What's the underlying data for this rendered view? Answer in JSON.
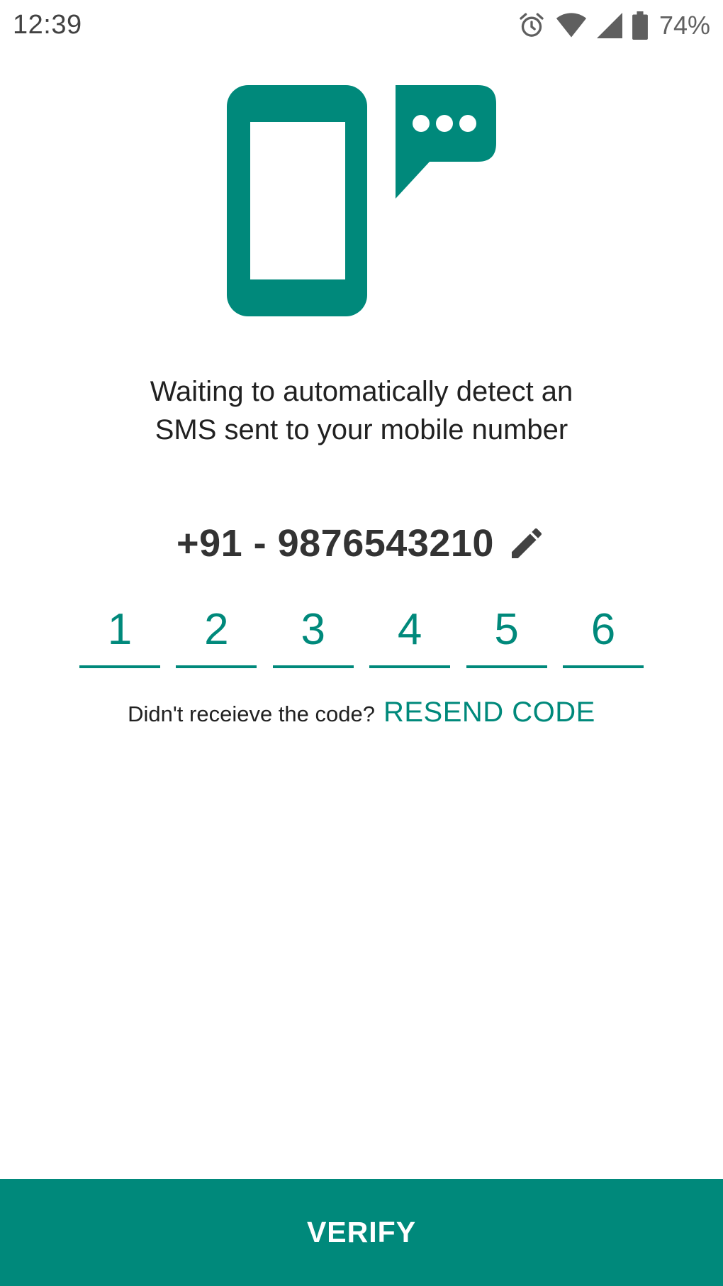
{
  "status_bar": {
    "time": "12:39",
    "battery_percent": "74%",
    "icons": [
      "alarm-icon",
      "wifi-icon",
      "cell-signal-icon",
      "battery-icon"
    ]
  },
  "illustration": {
    "icon": "phone-with-sms-bubble-icon",
    "color": "#00897b"
  },
  "message": {
    "line1": "Waiting to automatically detect an",
    "line2": "SMS sent to your mobile number"
  },
  "phone": {
    "number": "+91 - 9876543210",
    "edit_icon": "pencil-icon"
  },
  "otp": {
    "digits": [
      "1",
      "2",
      "3",
      "4",
      "5",
      "6"
    ]
  },
  "resend": {
    "prompt": "Didn't receieve the code?",
    "link": "RESEND CODE"
  },
  "verify": {
    "label": "VERIFY"
  },
  "colors": {
    "accent": "#00897b",
    "text": "#212121",
    "phone_text": "#333333"
  }
}
